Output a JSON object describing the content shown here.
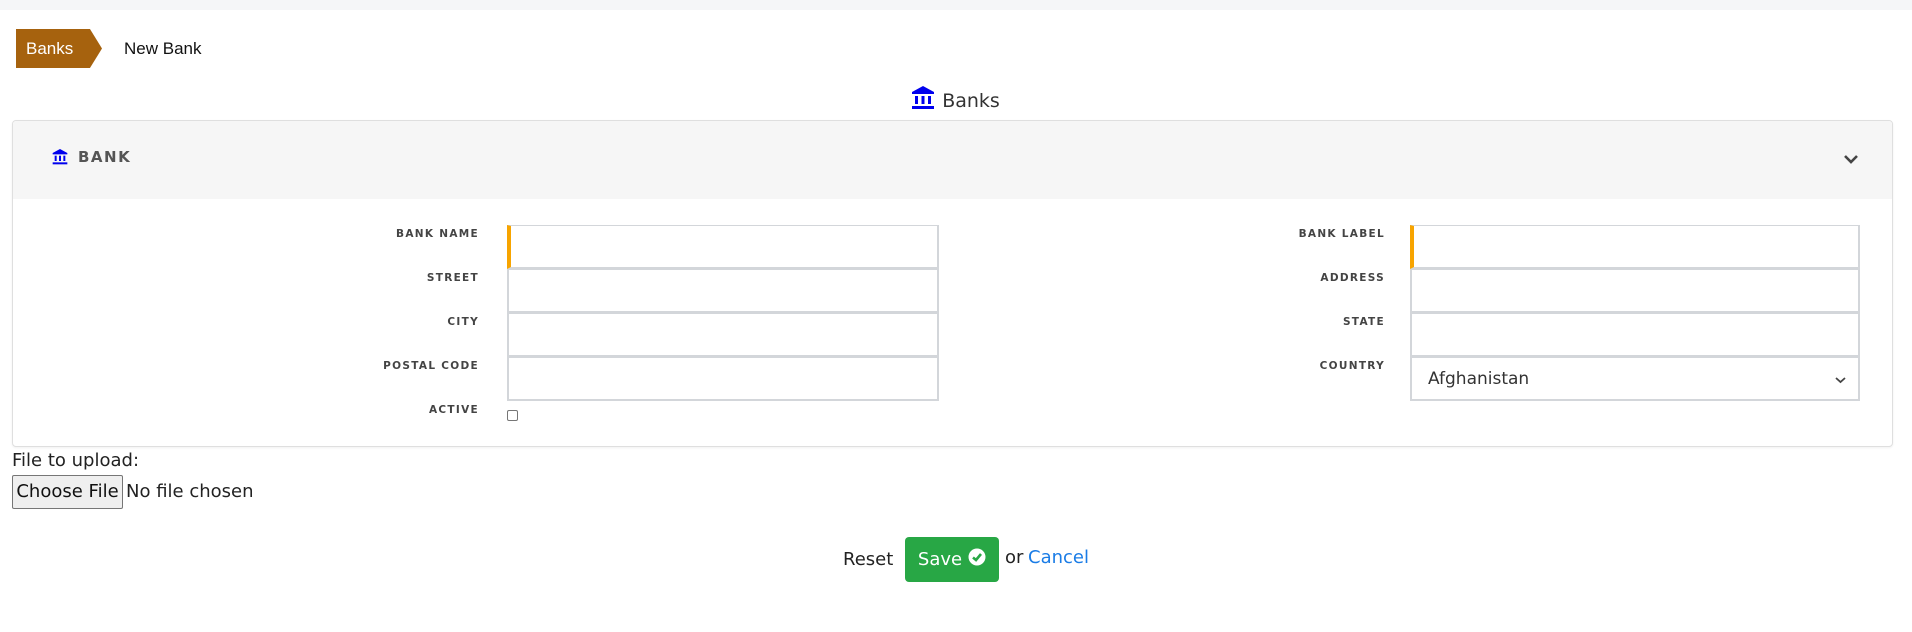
{
  "breadcrumb": {
    "items": [
      {
        "label": "Banks"
      },
      {
        "label": "New Bank"
      }
    ]
  },
  "page": {
    "title": "Banks",
    "title_icon": "bank-icon"
  },
  "section": {
    "title": "BANK",
    "icon": "bank-icon",
    "toggle_icon": "chevron-down-icon"
  },
  "form": {
    "left": [
      {
        "label": "BANK NAME",
        "value": "",
        "required": true
      },
      {
        "label": "STREET",
        "value": "",
        "required": false
      },
      {
        "label": "CITY",
        "value": "",
        "required": false
      },
      {
        "label": "POSTAL CODE",
        "value": "",
        "required": false
      }
    ],
    "right": [
      {
        "label": "BANK LABEL",
        "value": "",
        "required": true
      },
      {
        "label": "ADDRESS",
        "value": "",
        "required": false
      },
      {
        "label": "STATE",
        "value": "",
        "required": false
      },
      {
        "label": "COUNTRY",
        "value": "Afghanistan",
        "type": "select"
      }
    ],
    "active": {
      "label": "ACTIVE",
      "checked": false
    }
  },
  "upload": {
    "label": "File to upload:",
    "button": "Choose File",
    "status": "No file chosen"
  },
  "actions": {
    "reset": "Reset",
    "save": "Save",
    "save_icon": "check-circle-icon",
    "or": "or",
    "cancel": "Cancel"
  },
  "colors": {
    "breadcrumb_active": "#a6620e",
    "required_marker": "#f7a400",
    "save_button": "#28a745",
    "link": "#1a7ce6",
    "icon_blue": "#0000ee"
  }
}
